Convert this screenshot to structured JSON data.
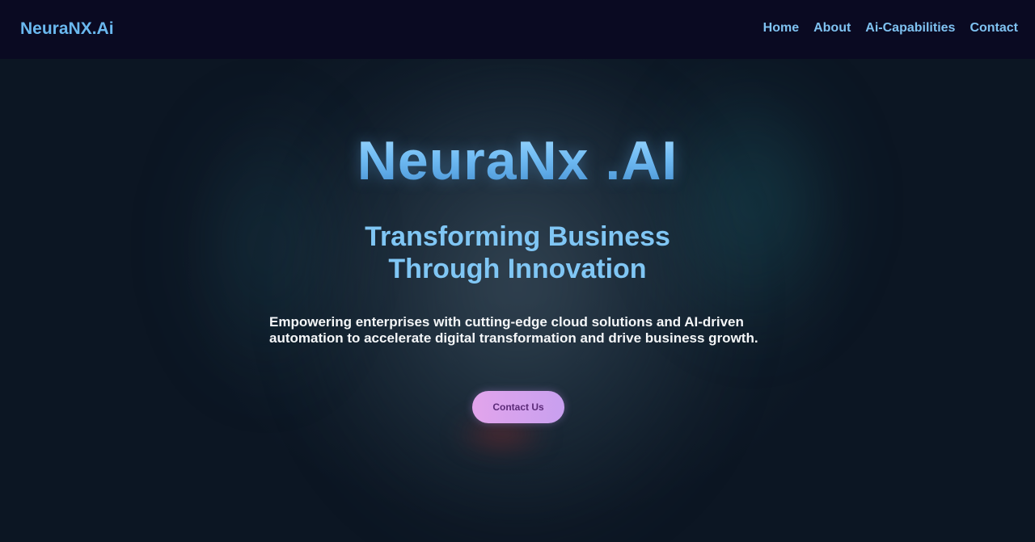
{
  "navbar": {
    "brand": "NeuraNX.Ai",
    "links": [
      {
        "label": "Home"
      },
      {
        "label": "About"
      },
      {
        "label": "Ai-Capabilities"
      },
      {
        "label": "Contact"
      }
    ]
  },
  "hero": {
    "title": "NeuraNx .AI",
    "subtitle": "Transforming Business Through Innovation",
    "description": "Empowering enterprises with cutting-edge cloud solutions and AI-driven automation to accelerate digital transformation and drive business growth.",
    "cta_label": "Contact Us"
  },
  "colors": {
    "navbar_bg": "#0a0a22",
    "brand_blue": "#6ab8ef",
    "cta_gradient_start": "#e2a4ec",
    "cta_gradient_end": "#c8a0ef",
    "cta_text": "#5b2a78"
  }
}
